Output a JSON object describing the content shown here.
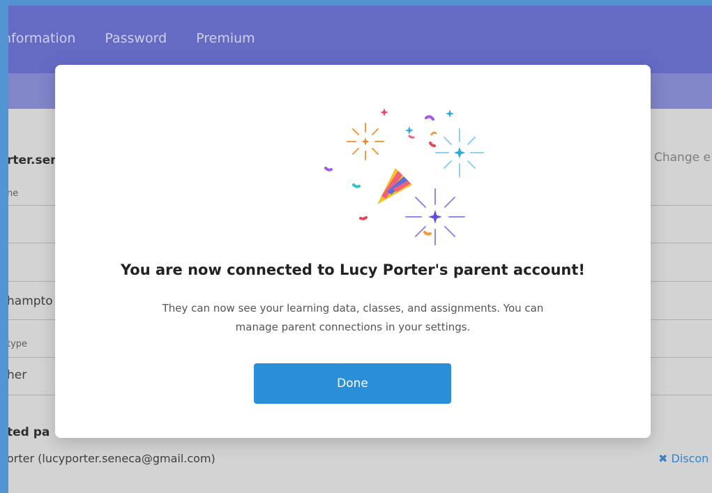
{
  "nav": {
    "tabs": [
      {
        "label": "nformation"
      },
      {
        "label": "Password"
      },
      {
        "label": "Premium"
      }
    ]
  },
  "background": {
    "email_partial": "rter.sen",
    "name_label_partial": "ne",
    "school_partial": "hampto",
    "type_label_partial": "type",
    "type_value_partial": "her",
    "connected_label_partial": "ted pa",
    "connected_parent": "orter (lucyporter.seneca@gmail.com)",
    "change_link": "Change e",
    "disconnect_link": "✖ Discon"
  },
  "modal": {
    "title": "You are now connected to Lucy Porter's parent account!",
    "body_line1": "They can now see your learning data, classes, and assignments. You can",
    "body_line2": "manage parent connections in your settings.",
    "done_label": "Done"
  },
  "colors": {
    "nav": "#6e75d6",
    "primary_button": "#2b8fd8",
    "disconnect": "#3a8fd9"
  }
}
